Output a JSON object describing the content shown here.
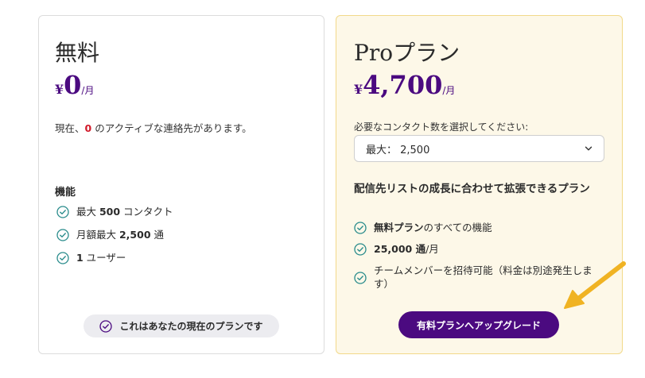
{
  "free_plan": {
    "title": "無料",
    "price_currency": "¥",
    "price_amount": "0",
    "price_period": "/月",
    "current_contacts_prefix": "現在、",
    "current_contacts_count": "0",
    "current_contacts_suffix": " のアクティブな連絡先があります。",
    "features_heading": "機能",
    "features": [
      {
        "prefix": "最大 ",
        "bold": "500",
        "suffix": " コンタクト"
      },
      {
        "prefix": "月額最大 ",
        "bold": "2,500",
        "suffix": " 通"
      },
      {
        "prefix": "",
        "bold": "1",
        "suffix": " ユーザー"
      }
    ],
    "current_plan_label": "これはあなたの現在のプランです"
  },
  "pro_plan": {
    "title": "Proプラン",
    "price_currency": "¥",
    "price_amount": "4,700",
    "price_period": "/月",
    "select_label": "必要なコンタクト数を選択してください:",
    "select_value": "最大： 2,500",
    "heading": "配信先リストの成長に合わせて拡張できるプラン",
    "features": [
      {
        "prefix": "",
        "bold": "無料プラン",
        "suffix": "のすべての機能"
      },
      {
        "prefix": "",
        "bold": "25,000 通",
        "suffix": "/月"
      },
      {
        "prefix": "",
        "bold": "",
        "suffix": "チームメンバーを招待可能（料金は別途発生します）"
      }
    ],
    "upgrade_label": "有料プランへアップグレード"
  },
  "colors": {
    "brand_purple": "#4b0a80",
    "check_teal": "#2a8c8c",
    "highlight_red": "#d11a2a",
    "arrow_yellow": "#f0b323"
  }
}
